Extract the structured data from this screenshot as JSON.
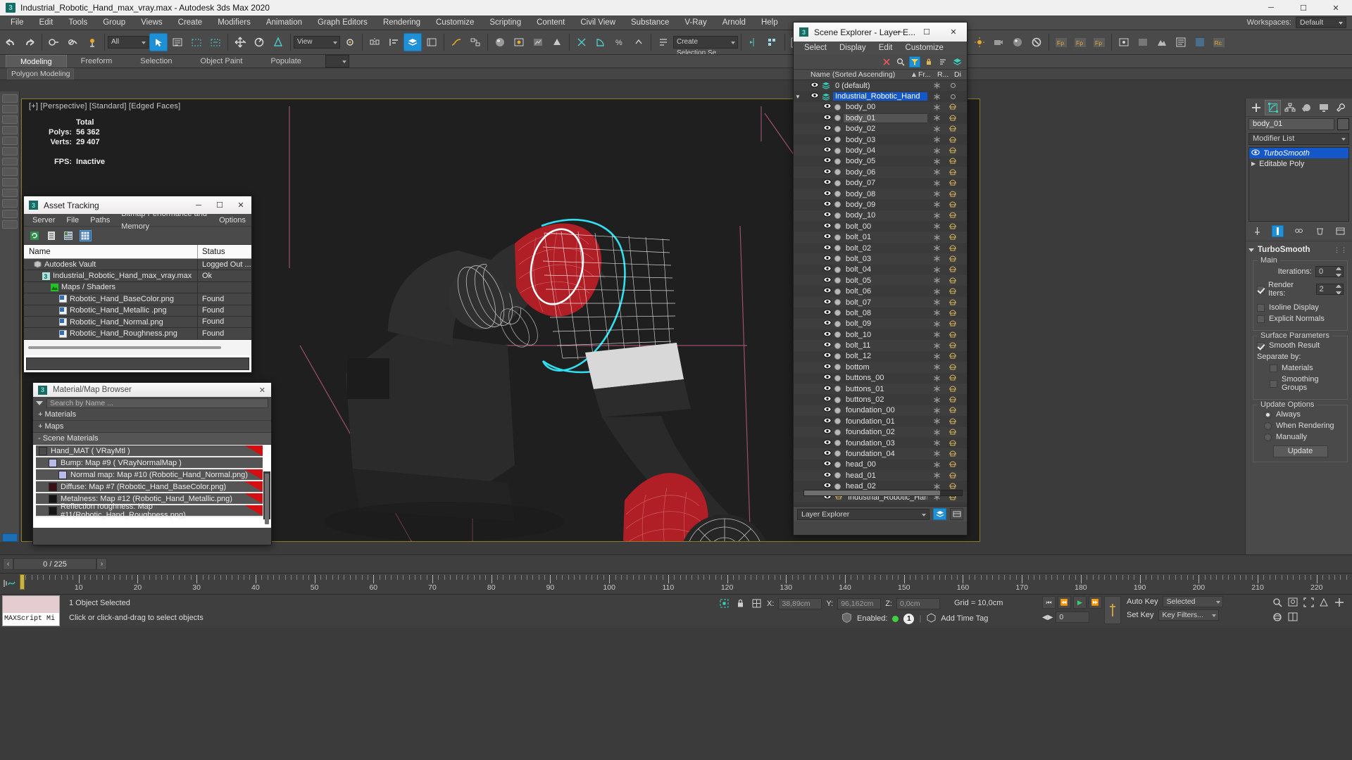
{
  "window": {
    "title": "Industrial_Robotic_Hand_max_vray.max - Autodesk 3ds Max 2020",
    "minimize": "─",
    "maximize": "☐",
    "close": "✕",
    "app_badge": "3"
  },
  "menubar": {
    "items": [
      "File",
      "Edit",
      "Tools",
      "Group",
      "Views",
      "Create",
      "Modifiers",
      "Animation",
      "Graph Editors",
      "Rendering",
      "Customize",
      "Scripting",
      "Content",
      "Civil View",
      "Substance",
      "V-Ray",
      "Arnold",
      "Help"
    ],
    "workspaces_label": "Workspaces:",
    "workspace_value": "Default"
  },
  "toolbar": {
    "selection_filter": "All",
    "view_combo": "View",
    "named_selection": "Create Selection Se"
  },
  "ribbon": {
    "tabs": [
      "Modeling",
      "Freeform",
      "Selection",
      "Object Paint",
      "Populate"
    ],
    "subtab": "Polygon Modeling"
  },
  "viewport": {
    "label": "[+] [Perspective] [Standard] [Edged Faces]",
    "stats_header": "Total",
    "stats": [
      {
        "key": "Polys:",
        "value": "56 362"
      },
      {
        "key": "Verts:",
        "value": "29 407"
      },
      {
        "key": "FPS:",
        "value": "Inactive"
      }
    ]
  },
  "asset_tracking": {
    "title": "Asset Tracking",
    "menu": [
      "Server",
      "File",
      "Paths",
      "Bitmap Performance and Memory",
      "Options"
    ],
    "columns": [
      "Name",
      "Status"
    ],
    "rows": [
      {
        "name": "Autodesk Vault",
        "status": "Logged Out ...",
        "indent": 0,
        "icon": "vault-icon"
      },
      {
        "name": "Industrial_Robotic_Hand_max_vray.max",
        "status": "Ok",
        "indent": 1,
        "icon": "max-file-icon"
      },
      {
        "name": "Maps / Shaders",
        "status": "",
        "indent": 2,
        "icon": "maps-icon"
      },
      {
        "name": "Robotic_Hand_BaseColor.png",
        "status": "Found",
        "indent": 3,
        "icon": "bitmap-icon"
      },
      {
        "name": "Robotic_Hand_Metallic .png",
        "status": "Found",
        "indent": 3,
        "icon": "bitmap-icon"
      },
      {
        "name": "Robotic_Hand_Normal.png",
        "status": "Found",
        "indent": 3,
        "icon": "bitmap-icon"
      },
      {
        "name": "Robotic_Hand_Roughness.png",
        "status": "Found",
        "indent": 3,
        "icon": "bitmap-icon"
      }
    ]
  },
  "material_browser": {
    "title": "Material/Map Browser",
    "search_placeholder": "Search by Name ...",
    "groups": [
      {
        "label": "+ Materials",
        "expanded": false
      },
      {
        "label": "+ Maps",
        "expanded": false
      },
      {
        "label": "- Scene Materials",
        "expanded": true
      }
    ],
    "scene_materials": [
      {
        "label": "Hand_MAT  ( VRayMtl )",
        "indent": 0,
        "swatch": "#4a4a4a",
        "flag": true
      },
      {
        "label": "Bump: Map #9  ( VRayNormalMap )",
        "indent": 1,
        "swatch": "#b8bbe8",
        "flag": false
      },
      {
        "label": "Normal map: Map #10 (Robotic_Hand_Normal.png)",
        "indent": 2,
        "swatch": "#b8bbe8",
        "flag": true
      },
      {
        "label": "Diffuse: Map #7 (Robotic_Hand_BaseColor.png)",
        "indent": 1,
        "swatch": "#3a1014",
        "flag": true
      },
      {
        "label": "Metalness: Map #12 (Robotic_Hand_Metallic.png)",
        "indent": 1,
        "swatch": "#141414",
        "flag": true
      },
      {
        "label": "Reflection roughness: Map #11(Robotic_Hand_Roughness.png)",
        "indent": 1,
        "swatch": "#161616",
        "flag": true
      }
    ]
  },
  "scene_explorer": {
    "title": "Scene Explorer - Layer E...",
    "menu": [
      "Select",
      "Display",
      "Edit",
      "Customize"
    ],
    "columns": {
      "name": "Name (Sorted Ascending)",
      "frozen": "Fr...",
      "render": "R...",
      "display": "Di"
    },
    "footer_combo": "Layer Explorer",
    "rows": [
      {
        "name": "0 (default)",
        "type": "layer",
        "indent": 0,
        "selected": false,
        "highlight": false
      },
      {
        "name": "Industrial_Robotic_Hand",
        "type": "layer",
        "indent": 0,
        "selected": true,
        "highlight": false
      },
      {
        "name": "body_00",
        "type": "object",
        "indent": 1,
        "selected": false,
        "highlight": false
      },
      {
        "name": "body_01",
        "type": "object",
        "indent": 1,
        "selected": false,
        "highlight": true
      },
      {
        "name": "body_02",
        "type": "object",
        "indent": 1,
        "selected": false,
        "highlight": false
      },
      {
        "name": "body_03",
        "type": "object",
        "indent": 1,
        "selected": false,
        "highlight": false
      },
      {
        "name": "body_04",
        "type": "object",
        "indent": 1,
        "selected": false,
        "highlight": false
      },
      {
        "name": "body_05",
        "type": "object",
        "indent": 1,
        "selected": false,
        "highlight": false
      },
      {
        "name": "body_06",
        "type": "object",
        "indent": 1,
        "selected": false,
        "highlight": false
      },
      {
        "name": "body_07",
        "type": "object",
        "indent": 1,
        "selected": false,
        "highlight": false
      },
      {
        "name": "body_08",
        "type": "object",
        "indent": 1,
        "selected": false,
        "highlight": false
      },
      {
        "name": "body_09",
        "type": "object",
        "indent": 1,
        "selected": false,
        "highlight": false
      },
      {
        "name": "body_10",
        "type": "object",
        "indent": 1,
        "selected": false,
        "highlight": false
      },
      {
        "name": "bolt_00",
        "type": "object",
        "indent": 1,
        "selected": false,
        "highlight": false
      },
      {
        "name": "bolt_01",
        "type": "object",
        "indent": 1,
        "selected": false,
        "highlight": false
      },
      {
        "name": "bolt_02",
        "type": "object",
        "indent": 1,
        "selected": false,
        "highlight": false
      },
      {
        "name": "bolt_03",
        "type": "object",
        "indent": 1,
        "selected": false,
        "highlight": false
      },
      {
        "name": "bolt_04",
        "type": "object",
        "indent": 1,
        "selected": false,
        "highlight": false
      },
      {
        "name": "bolt_05",
        "type": "object",
        "indent": 1,
        "selected": false,
        "highlight": false
      },
      {
        "name": "bolt_06",
        "type": "object",
        "indent": 1,
        "selected": false,
        "highlight": false
      },
      {
        "name": "bolt_07",
        "type": "object",
        "indent": 1,
        "selected": false,
        "highlight": false
      },
      {
        "name": "bolt_08",
        "type": "object",
        "indent": 1,
        "selected": false,
        "highlight": false
      },
      {
        "name": "bolt_09",
        "type": "object",
        "indent": 1,
        "selected": false,
        "highlight": false
      },
      {
        "name": "bolt_10",
        "type": "object",
        "indent": 1,
        "selected": false,
        "highlight": false
      },
      {
        "name": "bolt_11",
        "type": "object",
        "indent": 1,
        "selected": false,
        "highlight": false
      },
      {
        "name": "bolt_12",
        "type": "object",
        "indent": 1,
        "selected": false,
        "highlight": false
      },
      {
        "name": "bottom",
        "type": "object",
        "indent": 1,
        "selected": false,
        "highlight": false
      },
      {
        "name": "buttons_00",
        "type": "object",
        "indent": 1,
        "selected": false,
        "highlight": false
      },
      {
        "name": "buttons_01",
        "type": "object",
        "indent": 1,
        "selected": false,
        "highlight": false
      },
      {
        "name": "buttons_02",
        "type": "object",
        "indent": 1,
        "selected": false,
        "highlight": false
      },
      {
        "name": "foundation_00",
        "type": "object",
        "indent": 1,
        "selected": false,
        "highlight": false
      },
      {
        "name": "foundation_01",
        "type": "object",
        "indent": 1,
        "selected": false,
        "highlight": false
      },
      {
        "name": "foundation_02",
        "type": "object",
        "indent": 1,
        "selected": false,
        "highlight": false
      },
      {
        "name": "foundation_03",
        "type": "object",
        "indent": 1,
        "selected": false,
        "highlight": false
      },
      {
        "name": "foundation_04",
        "type": "object",
        "indent": 1,
        "selected": false,
        "highlight": false
      },
      {
        "name": "head_00",
        "type": "object",
        "indent": 1,
        "selected": false,
        "highlight": false
      },
      {
        "name": "head_01",
        "type": "object",
        "indent": 1,
        "selected": false,
        "highlight": false
      },
      {
        "name": "head_02",
        "type": "object",
        "indent": 1,
        "selected": false,
        "highlight": false
      },
      {
        "name": "Industrial_Robotic_Hand",
        "type": "group",
        "indent": 1,
        "selected": false,
        "highlight": false
      }
    ]
  },
  "command_panel": {
    "object_name": "body_01",
    "modifier_list_label": "Modifier List",
    "stack": [
      {
        "label": "TurboSmooth",
        "selected": true
      },
      {
        "label": "Editable Poly",
        "selected": false
      }
    ],
    "rollup": {
      "title": "TurboSmooth",
      "main_group": "Main",
      "iterations_label": "Iterations:",
      "iterations_value": "0",
      "render_iters_label": "Render Iters:",
      "render_iters_value": "2",
      "render_iters_checked": true,
      "isoline_label": "Isoline Display",
      "isoline_checked": false,
      "explicit_normals_label": "Explicit Normals",
      "explicit_normals_checked": false,
      "surface_group": "Surface Parameters",
      "smooth_result_label": "Smooth Result",
      "smooth_result_checked": true,
      "separate_by_label": "Separate by:",
      "separate_materials_label": "Materials",
      "separate_materials_checked": false,
      "separate_smoothing_label": "Smoothing Groups",
      "separate_smoothing_checked": false,
      "update_group": "Update Options",
      "update_always": "Always",
      "update_when_rendering": "When Rendering",
      "update_manually": "Manually",
      "update_selected": "Always",
      "update_button": "Update"
    }
  },
  "timeline": {
    "frame_display": "0 / 225",
    "prev_label": "‹",
    "next_label": "›",
    "tick_labels": [
      "10",
      "20",
      "30",
      "40",
      "50",
      "60",
      "70",
      "80",
      "90",
      "100",
      "110",
      "120",
      "130",
      "140",
      "150",
      "160",
      "170",
      "180",
      "190",
      "200",
      "210",
      "220"
    ]
  },
  "statusbar": {
    "maxscript_label": "MAXScript Mi",
    "selection_status": "1 Object Selected",
    "prompt": "Click or click-and-drag to select objects",
    "coords": [
      {
        "axis": "X:",
        "value": "38,89cm"
      },
      {
        "axis": "Y:",
        "value": "96,162cm"
      },
      {
        "axis": "Z:",
        "value": "0,0cm"
      }
    ],
    "grid": "Grid = 10,0cm",
    "enabled_label": "Enabled:",
    "enabled_count": "1",
    "add_time_tag": "Add Time Tag",
    "auto_key": "Auto Key",
    "set_key": "Set Key",
    "key_filters": "Key Filters...",
    "selected_combo": "Selected",
    "spinner_value": "0"
  }
}
